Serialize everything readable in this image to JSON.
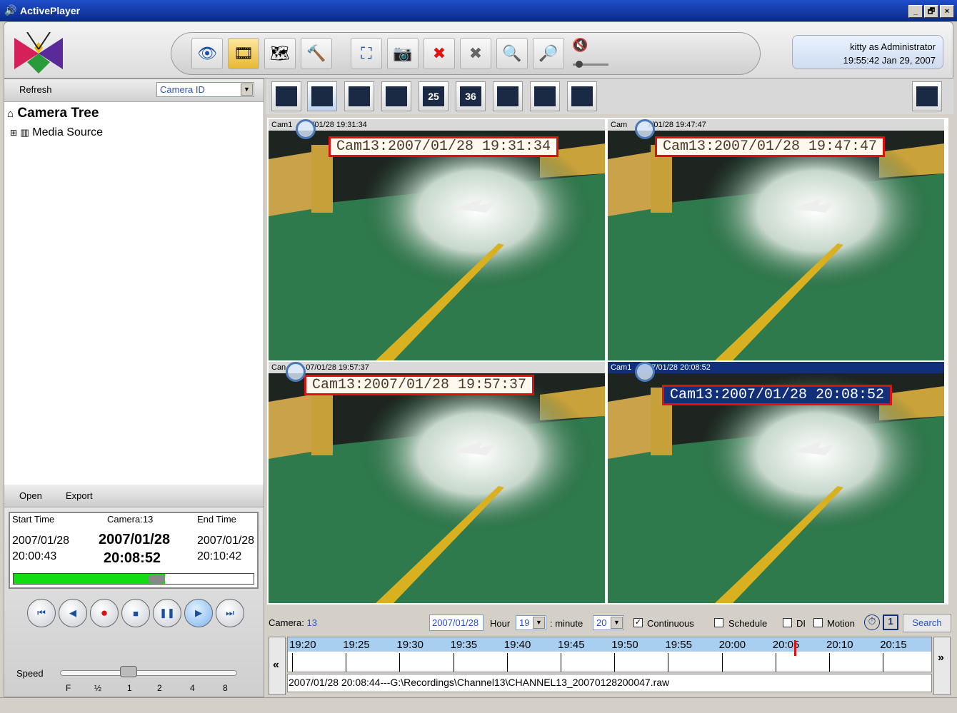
{
  "window": {
    "title": "ActivePlayer",
    "btn_min": "_",
    "btn_max": "🗗",
    "btn_close": "×"
  },
  "user": {
    "line1": "kitty as Administrator",
    "line2": "19:55:42 Jan 29, 2007"
  },
  "left": {
    "refresh": "Refresh",
    "filter": "Camera ID",
    "tree_title": "Camera Tree",
    "media_source": "Media Source",
    "expander": "⊞",
    "open": "Open",
    "export": "Export"
  },
  "info": {
    "start_label": "Start Time",
    "camera_label": "Camera:13",
    "end_label": "End Time",
    "start_date": "2007/01/28",
    "start_time": "20:00:43",
    "cur_date": "2007/01/28",
    "cur_time": "20:08:52",
    "end_date": "2007/01/28",
    "end_time": "20:10:42",
    "progress": 0.63
  },
  "speed": {
    "label": "Speed",
    "marks": [
      "F",
      "½",
      "1",
      "2",
      "4",
      "8"
    ]
  },
  "layouts": [
    "",
    "",
    "",
    "",
    "25",
    "36",
    "",
    "",
    ""
  ],
  "cams": [
    {
      "hdr_a": "Cam1",
      "hdr_b": "/01/28 19:31:34",
      "stamp": "Cam13:2007/01/28 19:31:34"
    },
    {
      "hdr_a": "Cam",
      "hdr_b": "7/01/28 19:47:47",
      "stamp": "Cam13:2007/01/28 19:47:47"
    },
    {
      "hdr_a": "Can",
      "hdr_b": "07/01/28 19:57:37",
      "stamp": "Cam13:2007/01/28 19:57:37"
    },
    {
      "hdr_a": "Cam1",
      "hdr_b": "7/01/28 20:08:52",
      "stamp": "Cam13:2007/01/28 20:08:52"
    }
  ],
  "search": {
    "camera_label": "Camera:",
    "camera_val": "13",
    "date": "2007/01/28",
    "hour_label": "Hour",
    "hour": "19",
    "minute_label": ": minute",
    "minute": "20",
    "continuous": "Continuous",
    "schedule": "Schedule",
    "di": "DI",
    "motion": "Motion",
    "search": "Search",
    "check": "✓",
    "one": "1",
    "prev": "«",
    "next": "»"
  },
  "timeline": {
    "labels": [
      "19:20",
      "19:25",
      "19:30",
      "19:35",
      "19:40",
      "19:45",
      "19:50",
      "19:55",
      "20:00",
      "20:05",
      "20:10",
      "20:15"
    ],
    "marker": "20:07",
    "file": "2007/01/28 20:08:44---G:\\Recordings\\Channel13\\CHANNEL13_20070128200047.raw"
  },
  "colors": {
    "accent": "#2a52be",
    "stamp_border": "#e01010",
    "progress": "#11dd11",
    "timeline": "#a9cff0"
  }
}
